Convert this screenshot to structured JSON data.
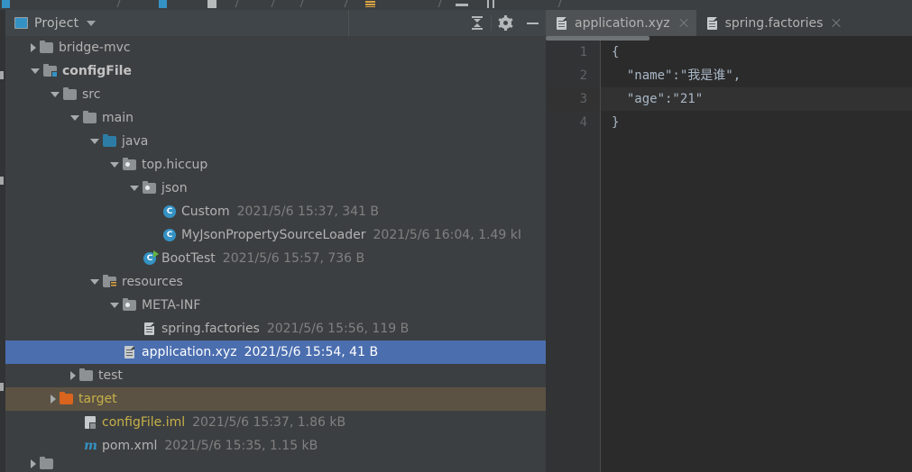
{
  "window": {
    "theme": "darcula",
    "accent_selected": "#4b6eaf",
    "accent_excluded": "#5b5243"
  },
  "toolbar_strip": {
    "name": "main-toolbar-partial",
    "visible_fragments": 10
  },
  "project_panel": {
    "header": {
      "title": "Project",
      "view_icon": "project-view-icon",
      "dropdown_icon": "chevron-down-icon",
      "tools": [
        {
          "name": "collapse-all-button",
          "icon": "collapse-all-icon"
        },
        {
          "name": "settings-button",
          "icon": "gear-icon"
        },
        {
          "name": "hide-panel-button",
          "icon": "minimize-icon"
        }
      ]
    },
    "tree": [
      {
        "label": "bridge-mvc",
        "meta": "",
        "indent": 1,
        "twisty": "closed",
        "icon": "folder-grey-icon",
        "style": "normal",
        "state": "normal"
      },
      {
        "label": "configFile",
        "meta": "",
        "indent": 1,
        "twisty": "open",
        "icon": "module-folder-icon",
        "style": "bold",
        "state": "normal"
      },
      {
        "label": "src",
        "meta": "",
        "indent": 2,
        "twisty": "open",
        "icon": "folder-grey-icon",
        "style": "normal",
        "state": "normal"
      },
      {
        "label": "main",
        "meta": "",
        "indent": 3,
        "twisty": "open",
        "icon": "folder-grey-icon",
        "style": "normal",
        "state": "normal"
      },
      {
        "label": "java",
        "meta": "",
        "indent": 4,
        "twisty": "open",
        "icon": "source-folder-blue-icon",
        "style": "normal",
        "state": "normal"
      },
      {
        "label": "top.hiccup",
        "meta": "",
        "indent": 5,
        "twisty": "open",
        "icon": "package-icon",
        "style": "normal",
        "state": "normal"
      },
      {
        "label": "json",
        "meta": "",
        "indent": 6,
        "twisty": "open",
        "icon": "package-icon",
        "style": "normal",
        "state": "normal"
      },
      {
        "label": "Custom",
        "meta": "2021/5/6 15:37, 341 B",
        "indent": 7,
        "twisty": "none",
        "icon": "java-class-icon",
        "style": "normal",
        "state": "normal"
      },
      {
        "label": "MyJsonPropertySourceLoader",
        "meta": "2021/5/6 16:04, 1.49 kI",
        "indent": 7,
        "twisty": "none",
        "icon": "java-class-icon",
        "style": "normal",
        "state": "normal"
      },
      {
        "label": "BootTest",
        "meta": "2021/5/6 15:57, 736 B",
        "indent": 6,
        "twisty": "none",
        "icon": "java-runnable-class-icon",
        "style": "normal",
        "state": "normal"
      },
      {
        "label": "resources",
        "meta": "",
        "indent": 4,
        "twisty": "open",
        "icon": "resources-folder-icon",
        "style": "normal",
        "state": "normal"
      },
      {
        "label": "META-INF",
        "meta": "",
        "indent": 5,
        "twisty": "open",
        "icon": "package-icon",
        "style": "normal",
        "state": "normal"
      },
      {
        "label": "spring.factories",
        "meta": "2021/5/6 15:56, 119 B",
        "indent": 6,
        "twisty": "none",
        "icon": "file-icon",
        "style": "normal",
        "state": "normal"
      },
      {
        "label": "application.xyz",
        "meta": "2021/5/6 15:54, 41 B",
        "indent": 5,
        "twisty": "none",
        "icon": "file-icon",
        "style": "normal",
        "state": "selected"
      },
      {
        "label": "test",
        "meta": "",
        "indent": 3,
        "twisty": "closed",
        "icon": "folder-grey-icon",
        "style": "normal",
        "state": "normal"
      },
      {
        "label": "target",
        "meta": "",
        "indent": 2,
        "twisty": "closed",
        "icon": "folder-orange-icon",
        "style": "yellow",
        "state": "excluded"
      },
      {
        "label": "configFile.iml",
        "meta": "2021/5/6 15:37, 1.86 kB",
        "indent": 3,
        "twisty": "none",
        "icon": "iml-file-icon",
        "style": "yellow",
        "state": "normal"
      },
      {
        "label": "pom.xml",
        "meta": "2021/5/6 15:35, 1.15 kB",
        "indent": 3,
        "twisty": "none",
        "icon": "maven-file-icon",
        "style": "normal",
        "state": "normal"
      },
      {
        "label": "",
        "meta": "",
        "indent": 1,
        "twisty": "closed",
        "icon": "folder-grey-icon",
        "style": "normal",
        "state": "clipped"
      }
    ]
  },
  "editor": {
    "tabs": [
      {
        "label": "application.xyz",
        "icon": "file-icon",
        "active": true,
        "close_icon": "close-icon"
      },
      {
        "label": "spring.factories",
        "icon": "file-icon",
        "active": false,
        "close_icon": "close-icon"
      }
    ],
    "gutter": {
      "line_numbers": [
        "1",
        "2",
        "3",
        "4"
      ]
    },
    "caret_line": 3,
    "content": [
      {
        "n": "1",
        "text": "{"
      },
      {
        "n": "2",
        "text": "  \"name\":\"我是谁\","
      },
      {
        "n": "3",
        "text": "  \"age\":\"21\""
      },
      {
        "n": "4",
        "text": "}"
      }
    ],
    "scrollbar": {
      "name": "horizontal-scrollbar",
      "thumb_fraction": 0.28
    }
  }
}
